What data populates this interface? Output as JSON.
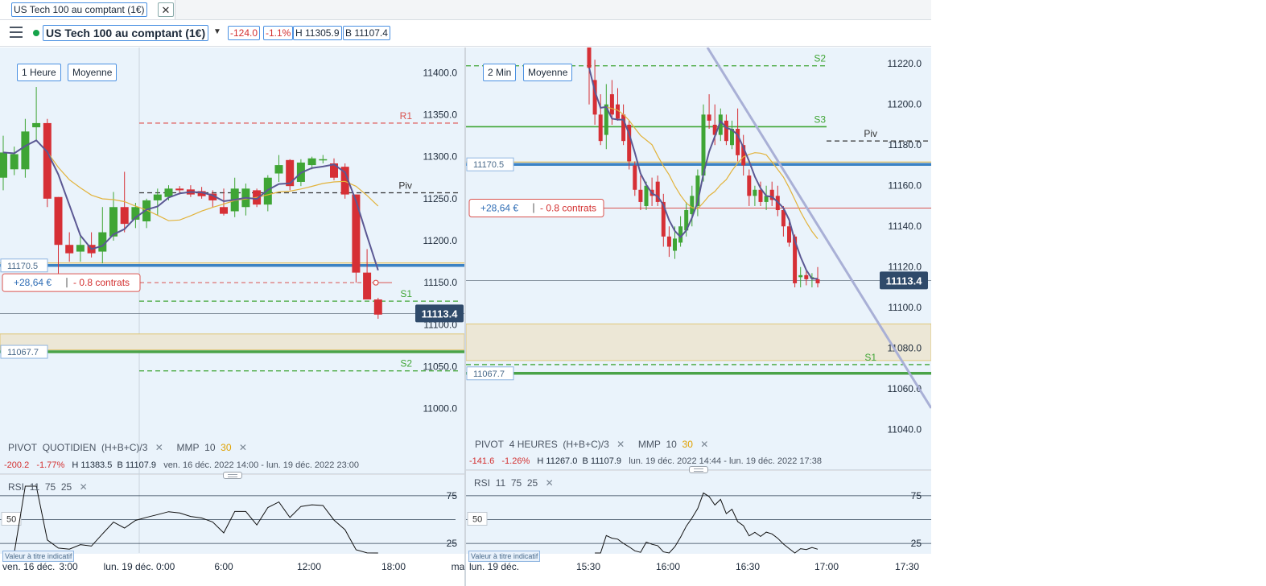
{
  "tab": {
    "title": "US Tech 100 au comptant (1€)",
    "close": "✕"
  },
  "toolbar": {
    "instrument": "US Tech 100 au comptant (1€)",
    "change": "-124.0",
    "change_pct": "-1.1%",
    "high": "H 11305.9",
    "bid": "B 11107.4"
  },
  "left": {
    "timeframe": "1 Heure",
    "chart_style": "Moyenne",
    "price_ticks": [
      "11400.0",
      "11350.0",
      "11300.0",
      "11250.0",
      "11200.0",
      "11150.0",
      "11100.0",
      "11050.0",
      "11000.0"
    ],
    "time_ticks": [
      "ven. 16 déc.",
      "3:00",
      "lun. 19 déc. 0:00",
      "6:00",
      "12:00",
      "18:00",
      "ma"
    ],
    "level_labels": {
      "r1": "R1",
      "piv": "Piv",
      "s1": "S1",
      "s2": "S2"
    },
    "order_price": "11170.5",
    "stop_price": "11067.7",
    "current_price": "11113.4",
    "position_pnl": "+28,64 €",
    "position_size": "- 0.8 contrats",
    "indicators": {
      "pivot_name": "PIVOT",
      "pivot_period": "QUOTIDIEN",
      "pivot_formula": "(H+B+C)/3",
      "mmp_name": "MMP",
      "mmp_a": "10",
      "mmp_b": "30",
      "close": "✕"
    },
    "stats": {
      "change": "-200.2",
      "change_pct": "-1.77%",
      "high": "H 11383.5",
      "low": "B 11107.9",
      "range": "ven. 16 déc. 2022 14:00 - lun. 19 déc. 2022 23:00"
    },
    "rsi": {
      "name": "RSI",
      "period": "11",
      "upper": "75",
      "lower": "25",
      "mid": "50",
      "close": "✕"
    },
    "note": "Valeur à titre indicatif"
  },
  "right": {
    "timeframe": "2 Min",
    "chart_style": "Moyenne",
    "price_ticks": [
      "11220.0",
      "11200.0",
      "11180.0",
      "11160.0",
      "11140.0",
      "11120.0",
      "11100.0",
      "11080.0",
      "11060.0",
      "11040.0"
    ],
    "time_ticks": [
      "lun. 19 déc.",
      "15:30",
      "16:00",
      "16:30",
      "17:00",
      "17:30"
    ],
    "level_labels": {
      "s2": "S2",
      "s3": "S3",
      "piv": "Piv",
      "s1": "S1"
    },
    "order_price": "11170.5",
    "stop_price": "11067.7",
    "current_price": "11113.4",
    "position_pnl": "+28,64 €",
    "position_size": "- 0.8 contrats",
    "indicators": {
      "pivot_name": "PIVOT",
      "pivot_period": "4 HEURES",
      "pivot_formula": "(H+B+C)/3",
      "mmp_name": "MMP",
      "mmp_a": "10",
      "mmp_b": "30",
      "close": "✕"
    },
    "stats": {
      "change": "-141.6",
      "change_pct": "-1.26%",
      "high": "H 11267.0",
      "low": "B 11107.9",
      "range": "lun. 19 déc. 2022 14:44 - lun. 19 déc. 2022 17:38"
    },
    "rsi": {
      "name": "RSI",
      "period": "11",
      "upper": "75",
      "lower": "25",
      "mid": "50",
      "close": "✕"
    },
    "note": "Valeur à titre indicatif"
  },
  "colors": {
    "up": "#3fa535",
    "down": "#d62f35",
    "bg": "#eaf3fb",
    "ma_fast": "#5b5893",
    "ma_slow": "#e2b33c",
    "order_line": "#3b82c4",
    "stop_line": "#4aa348"
  },
  "chart_data": [
    {
      "type": "candlestick",
      "title": "US Tech 100 au comptant (1€) — 1 Heure",
      "ylim": [
        10970,
        11430
      ],
      "levels": {
        "R1": 11340,
        "Piv": 11257,
        "S1": 11128,
        "S2": 11045
      },
      "order_level": 11170.5,
      "stop_level": 11067.7,
      "position_level": 11150,
      "current": 11113.4,
      "zone": [
        11070,
        11089
      ],
      "candles": [
        {
          "o": 11275,
          "h": 11325,
          "l": 11260,
          "c": 11305
        },
        {
          "o": 11285,
          "h": 11312,
          "l": 11278,
          "c": 11303
        },
        {
          "o": 11285,
          "h": 11345,
          "l": 11275,
          "c": 11330
        },
        {
          "o": 11335,
          "h": 11383,
          "l": 11320,
          "c": 11340
        },
        {
          "o": 11340,
          "h": 11345,
          "l": 11240,
          "c": 11250
        },
        {
          "o": 11252,
          "h": 11252,
          "l": 11160,
          "c": 11195
        },
        {
          "o": 11195,
          "h": 11210,
          "l": 11175,
          "c": 11185
        },
        {
          "o": 11187,
          "h": 11205,
          "l": 11175,
          "c": 11195
        },
        {
          "o": 11195,
          "h": 11210,
          "l": 11180,
          "c": 11185
        },
        {
          "o": 11187,
          "h": 11240,
          "l": 11173,
          "c": 11210
        },
        {
          "o": 11205,
          "h": 11258,
          "l": 11200,
          "c": 11240
        },
        {
          "o": 11240,
          "h": 11282,
          "l": 11210,
          "c": 11220
        },
        {
          "o": 11225,
          "h": 11245,
          "l": 11215,
          "c": 11240
        },
        {
          "o": 11223,
          "h": 11250,
          "l": 11215,
          "c": 11248
        },
        {
          "o": 11248,
          "h": 11262,
          "l": 11230,
          "c": 11255
        },
        {
          "o": 11252,
          "h": 11266,
          "l": 11248,
          "c": 11262
        },
        {
          "o": 11262,
          "h": 11265,
          "l": 11255,
          "c": 11260
        },
        {
          "o": 11261,
          "h": 11266,
          "l": 11252,
          "c": 11255
        },
        {
          "o": 11259,
          "h": 11264,
          "l": 11250,
          "c": 11253
        },
        {
          "o": 11256,
          "h": 11260,
          "l": 11240,
          "c": 11248
        },
        {
          "o": 11240,
          "h": 11262,
          "l": 11230,
          "c": 11232
        },
        {
          "o": 11235,
          "h": 11275,
          "l": 11228,
          "c": 11262
        },
        {
          "o": 11240,
          "h": 11268,
          "l": 11230,
          "c": 11262
        },
        {
          "o": 11260,
          "h": 11262,
          "l": 11240,
          "c": 11243
        },
        {
          "o": 11243,
          "h": 11278,
          "l": 11235,
          "c": 11275
        },
        {
          "o": 11280,
          "h": 11302,
          "l": 11270,
          "c": 11290
        },
        {
          "o": 11296,
          "h": 11297,
          "l": 11260,
          "c": 11265
        },
        {
          "o": 11270,
          "h": 11297,
          "l": 11265,
          "c": 11293
        },
        {
          "o": 11290,
          "h": 11300,
          "l": 11285,
          "c": 11298
        },
        {
          "o": 11296,
          "h": 11302,
          "l": 11292,
          "c": 11297
        },
        {
          "o": 11292,
          "h": 11298,
          "l": 11272,
          "c": 11275
        },
        {
          "o": 11288,
          "h": 11292,
          "l": 11250,
          "c": 11255
        },
        {
          "o": 11255,
          "h": 11255,
          "l": 11150,
          "c": 11162
        },
        {
          "o": 11162,
          "h": 11190,
          "l": 11140,
          "c": 11130
        },
        {
          "o": 11130,
          "h": 11132,
          "l": 11107,
          "c": 11112
        }
      ]
    },
    {
      "type": "candlestick",
      "title": "US Tech 100 au comptant (1€) — 2 Min",
      "ylim": [
        11030,
        11228
      ],
      "levels": {
        "S2": 11219,
        "S3": 11189,
        "Piv": 11182,
        "S1": 11072
      },
      "order_level": 11170.5,
      "stop_level": 11067.7,
      "position_level": 11149,
      "current": 11113.4,
      "zone": [
        11074,
        11092
      ],
      "candles": [
        {
          "o": 11228,
          "h": 11230,
          "l": 11200,
          "c": 11218
        },
        {
          "o": 11212,
          "h": 11222,
          "l": 11190,
          "c": 11195
        },
        {
          "o": 11195,
          "h": 11205,
          "l": 11180,
          "c": 11182
        },
        {
          "o": 11185,
          "h": 11210,
          "l": 11178,
          "c": 11200
        },
        {
          "o": 11205,
          "h": 11212,
          "l": 11190,
          "c": 11195
        },
        {
          "o": 11200,
          "h": 11208,
          "l": 11192,
          "c": 11193
        },
        {
          "o": 11195,
          "h": 11200,
          "l": 11180,
          "c": 11182
        },
        {
          "o": 11190,
          "h": 11192,
          "l": 11168,
          "c": 11172
        },
        {
          "o": 11170,
          "h": 11172,
          "l": 11155,
          "c": 11158
        },
        {
          "o": 11158,
          "h": 11165,
          "l": 11148,
          "c": 11152
        },
        {
          "o": 11150,
          "h": 11162,
          "l": 11148,
          "c": 11160
        },
        {
          "o": 11158,
          "h": 11164,
          "l": 11150,
          "c": 11155
        },
        {
          "o": 11162,
          "h": 11165,
          "l": 11150,
          "c": 11152
        },
        {
          "o": 11152,
          "h": 11156,
          "l": 11130,
          "c": 11135
        },
        {
          "o": 11135,
          "h": 11140,
          "l": 11125,
          "c": 11130
        },
        {
          "o": 11128,
          "h": 11140,
          "l": 11124,
          "c": 11134
        },
        {
          "o": 11132,
          "h": 11145,
          "l": 11130,
          "c": 11140
        },
        {
          "o": 11138,
          "h": 11152,
          "l": 11135,
          "c": 11148
        },
        {
          "o": 11146,
          "h": 11160,
          "l": 11140,
          "c": 11155
        },
        {
          "o": 11150,
          "h": 11168,
          "l": 11145,
          "c": 11165
        },
        {
          "o": 11165,
          "h": 11200,
          "l": 11162,
          "c": 11195
        },
        {
          "o": 11195,
          "h": 11205,
          "l": 11188,
          "c": 11192
        },
        {
          "o": 11190,
          "h": 11200,
          "l": 11180,
          "c": 11185
        },
        {
          "o": 11185,
          "h": 11198,
          "l": 11182,
          "c": 11195
        },
        {
          "o": 11192,
          "h": 11195,
          "l": 11180,
          "c": 11182
        },
        {
          "o": 11180,
          "h": 11192,
          "l": 11178,
          "c": 11188
        },
        {
          "o": 11188,
          "h": 11198,
          "l": 11172,
          "c": 11175
        },
        {
          "o": 11180,
          "h": 11185,
          "l": 11165,
          "c": 11170
        },
        {
          "o": 11165,
          "h": 11168,
          "l": 11150,
          "c": 11155
        },
        {
          "o": 11155,
          "h": 11160,
          "l": 11150,
          "c": 11158
        },
        {
          "o": 11158,
          "h": 11162,
          "l": 11150,
          "c": 11152
        },
        {
          "o": 11152,
          "h": 11160,
          "l": 11148,
          "c": 11155
        },
        {
          "o": 11158,
          "h": 11162,
          "l": 11150,
          "c": 11153
        },
        {
          "o": 11155,
          "h": 11160,
          "l": 11145,
          "c": 11148
        },
        {
          "o": 11148,
          "h": 11150,
          "l": 11135,
          "c": 11140
        },
        {
          "o": 11140,
          "h": 11142,
          "l": 11130,
          "c": 11132
        },
        {
          "o": 11135,
          "h": 11136,
          "l": 11110,
          "c": 11112
        },
        {
          "o": 11115,
          "h": 11120,
          "l": 11110,
          "c": 11116
        },
        {
          "o": 11116,
          "h": 11118,
          "l": 11111,
          "c": 11114
        },
        {
          "o": 11115,
          "h": 11117,
          "l": 11110,
          "c": 11115
        },
        {
          "o": 11114,
          "h": 11120,
          "l": 11110,
          "c": 11112
        }
      ]
    }
  ]
}
